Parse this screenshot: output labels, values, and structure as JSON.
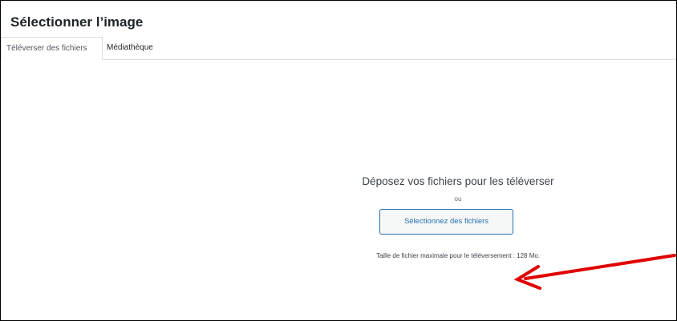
{
  "modal": {
    "title": "Sélectionner l’image"
  },
  "tabs": [
    {
      "label": "Téléverser des fichiers",
      "active": true
    },
    {
      "label": "Médiathèque",
      "active": false
    }
  ],
  "uploader": {
    "drop_title": "Déposez vos fichiers pour les téléverser",
    "or_label": "ou",
    "select_button_label": "Sélectionnez des fichiers",
    "max_size_text": "Taille de fichier maximale pour le téléversement : 128 Mo."
  },
  "colors": {
    "accent": "#2271b1",
    "annotation_arrow": "#e00000",
    "border": "#dcdcde"
  },
  "annotation": {
    "icon": "red-arrow-pointing-left"
  }
}
